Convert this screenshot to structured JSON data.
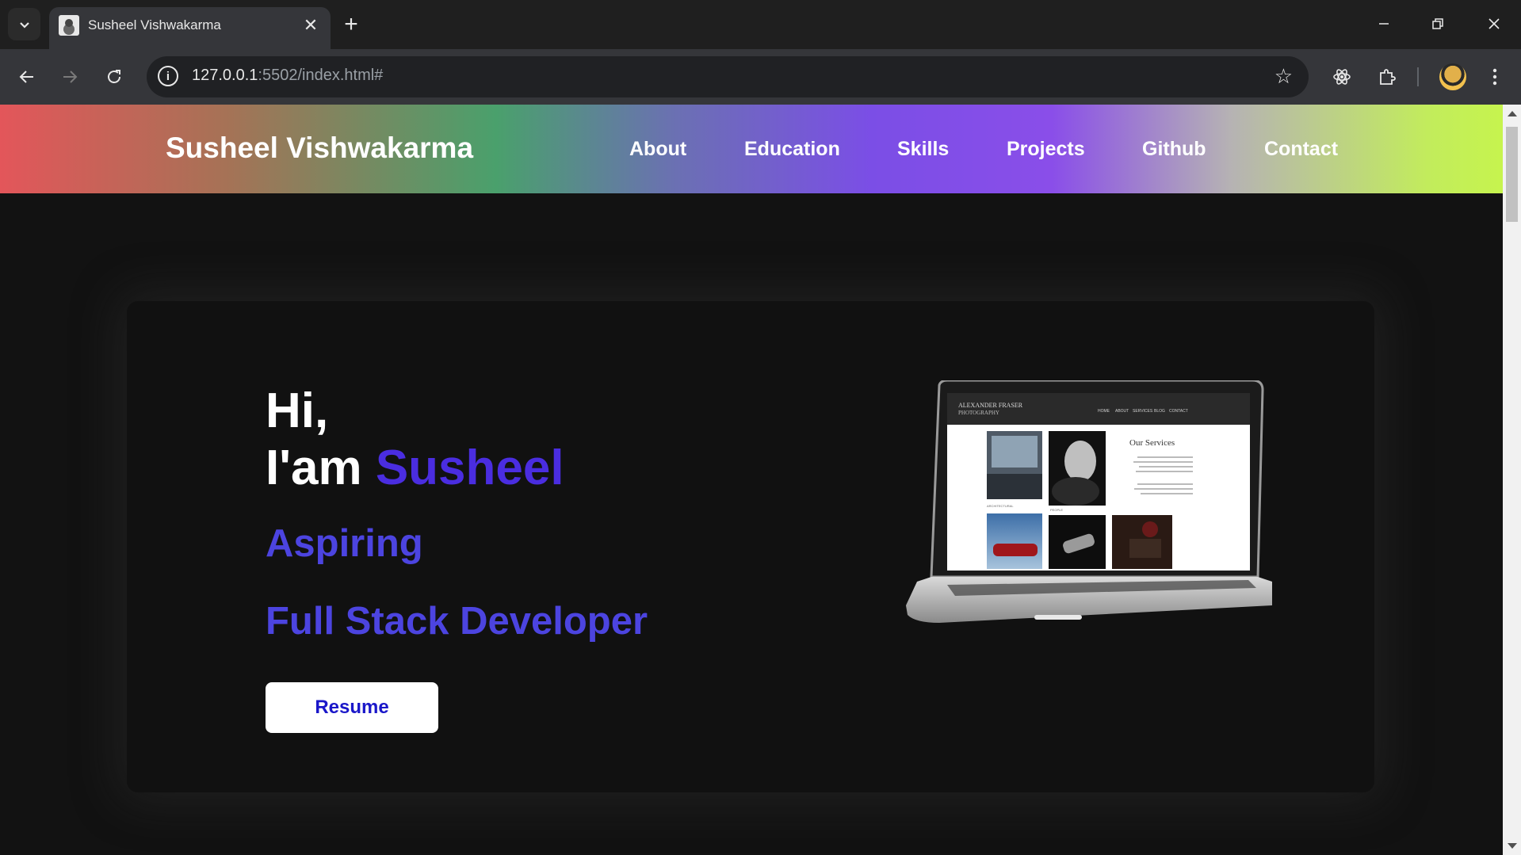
{
  "browser": {
    "tab_title": "Susheel Vishwakarma",
    "url_host": "127.0.0.1",
    "url_rest": ":5502/index.html#"
  },
  "site": {
    "brand": "Susheel Vishwakarma",
    "nav": [
      "About",
      "Education",
      "Skills",
      "Projects",
      "Github",
      "Contact"
    ]
  },
  "hero": {
    "greeting_line1": "Hi,",
    "greeting_line2_prefix": "I'am ",
    "greeting_name": "Susheel",
    "role_line1": "Aspiring",
    "role_line2": "Full Stack Developer",
    "resume_label": "Resume"
  },
  "laptop_screen": {
    "site_title_line1": "ALEXANDER FRASER",
    "site_title_line2": "PHOTOGRAPHY",
    "menu": [
      "HOME",
      "ABOUT",
      "SERVICES",
      "BLOG",
      "CONTACT"
    ],
    "heading": "Our Services",
    "captions": [
      "ARCHITECTURAL",
      "PEOPLE"
    ]
  },
  "colors": {
    "accent_name": "#4a2de0",
    "accent_role": "#4c44e0",
    "resume_text": "#1a17c9"
  }
}
